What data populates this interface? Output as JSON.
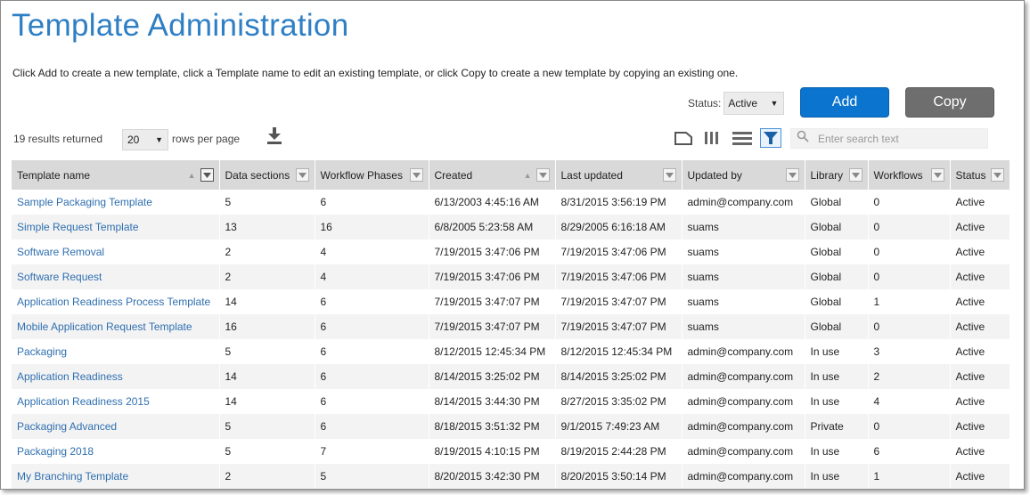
{
  "page": {
    "title": "Template Administration",
    "instructions": "Click Add to create a new template, click a Template name to edit an existing template, or click Copy to create a new template by copying an existing one."
  },
  "status_filter": {
    "label": "Status:",
    "value": "Active"
  },
  "buttons": {
    "add": "Add",
    "copy": "Copy"
  },
  "results": {
    "count_text": "19 results returned",
    "rows_per_page": "20",
    "rows_per_page_label": "rows per page"
  },
  "search": {
    "placeholder": "Enter search text"
  },
  "icons": {
    "download": "download-icon",
    "card_view": "card-view-icon",
    "column_view": "columns-view-icon",
    "list_view": "list-view-icon",
    "filter": "filter-icon",
    "search": "search-icon"
  },
  "colors": {
    "title": "#2f7fc4",
    "add_button": "#0a74cf",
    "copy_button": "#6e6e6e",
    "link": "#2f6fb0",
    "header_bg": "#d9d9d9",
    "filter_active": "#0a74cf"
  },
  "table": {
    "columns": [
      "Template name",
      "Data sections",
      "Workflow Phases",
      "Created",
      "Last updated",
      "Updated by",
      "Library",
      "Workflows",
      "Status"
    ],
    "rows": [
      [
        "Sample Packaging Template",
        "5",
        "6",
        "6/13/2003 4:45:16 AM",
        "8/31/2015 3:56:19 PM",
        "admin@company.com",
        "Global",
        "0",
        "Active"
      ],
      [
        "Simple Request Template",
        "13",
        "16",
        "6/8/2005 5:23:58 AM",
        "8/29/2005 6:16:18 AM",
        "suams",
        "Global",
        "0",
        "Active"
      ],
      [
        "Software Removal",
        "2",
        "4",
        "7/19/2015 3:47:06 PM",
        "7/19/2015 3:47:06 PM",
        "suams",
        "Global",
        "0",
        "Active"
      ],
      [
        "Software Request",
        "2",
        "4",
        "7/19/2015 3:47:06 PM",
        "7/19/2015 3:47:06 PM",
        "suams",
        "Global",
        "0",
        "Active"
      ],
      [
        "Application Readiness Process Template",
        "14",
        "6",
        "7/19/2015 3:47:07 PM",
        "7/19/2015 3:47:07 PM",
        "suams",
        "Global",
        "1",
        "Active"
      ],
      [
        "Mobile Application Request Template",
        "16",
        "6",
        "7/19/2015 3:47:07 PM",
        "7/19/2015 3:47:07 PM",
        "suams",
        "Global",
        "0",
        "Active"
      ],
      [
        "Packaging",
        "5",
        "6",
        "8/12/2015 12:45:34 PM",
        "8/12/2015 12:45:34 PM",
        "admin@company.com",
        "In use",
        "3",
        "Active"
      ],
      [
        "Application Readiness",
        "14",
        "6",
        "8/14/2015 3:25:02 PM",
        "8/14/2015 3:25:02 PM",
        "admin@company.com",
        "In use",
        "2",
        "Active"
      ],
      [
        "Application Readiness 2015",
        "14",
        "6",
        "8/14/2015 3:44:30 PM",
        "8/27/2015 3:35:02 PM",
        "admin@company.com",
        "In use",
        "4",
        "Active"
      ],
      [
        "Packaging Advanced",
        "5",
        "6",
        "8/18/2015 3:51:32 PM",
        "9/1/2015 7:49:23 AM",
        "admin@company.com",
        "Private",
        "0",
        "Active"
      ],
      [
        "Packaging 2018",
        "5",
        "7",
        "8/19/2015 4:10:15 PM",
        "8/19/2015 2:44:28 PM",
        "admin@company.com",
        "In use",
        "6",
        "Active"
      ],
      [
        "My Branching Template",
        "2",
        "5",
        "8/20/2015 3:42:30 PM",
        "8/20/2015 3:50:14 PM",
        "admin@company.com",
        "In use",
        "1",
        "Active"
      ]
    ]
  }
}
